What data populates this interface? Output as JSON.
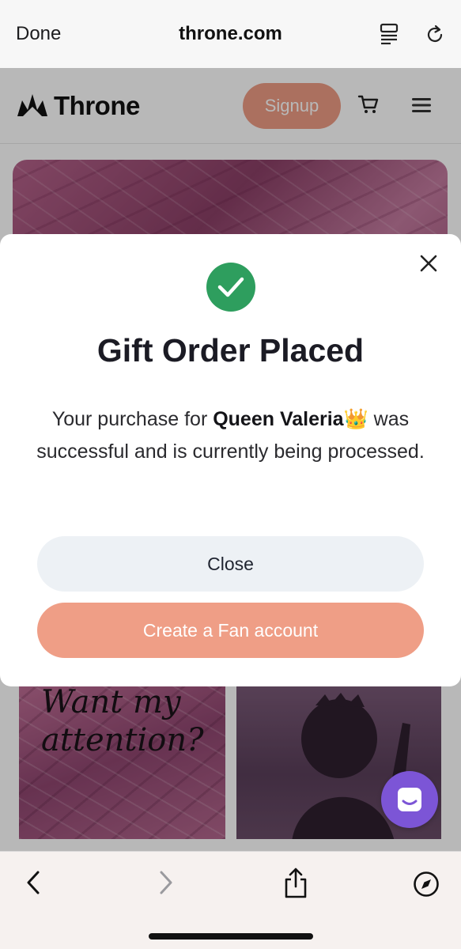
{
  "safari": {
    "done_label": "Done",
    "url": "throne.com"
  },
  "site": {
    "brand": "Throne",
    "signup_label": "Signup"
  },
  "cards": {
    "left_text_line1": "Want my",
    "left_text_line2": "attention?"
  },
  "modal": {
    "title": "Gift Order Placed",
    "message_prefix": "Your purchase for ",
    "recipient": "Queen Valeria",
    "recipient_emoji": "👑",
    "message_suffix": " was successful and is currently being processed.",
    "close_label": "Close",
    "fan_label": "Create a Fan account"
  },
  "colors": {
    "accent": "#ef9e86",
    "success": "#2e9e5e",
    "chat": "#7c55d6"
  }
}
